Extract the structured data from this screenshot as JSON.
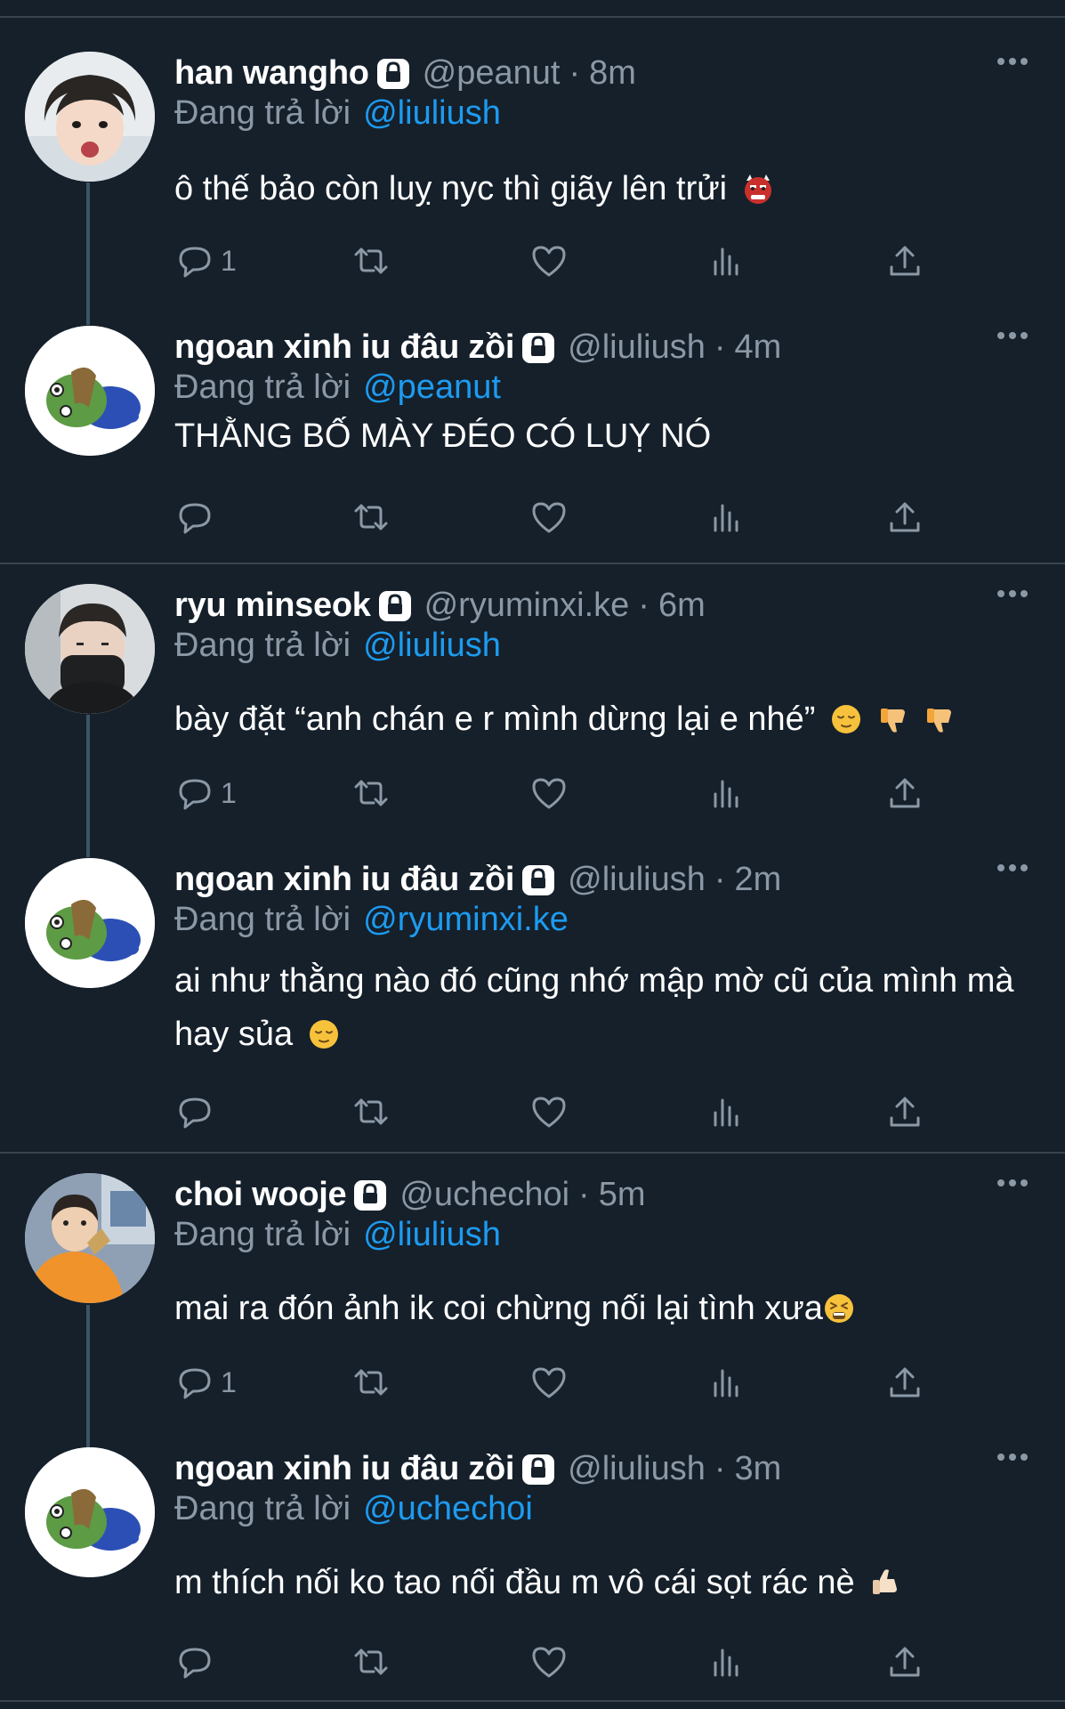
{
  "reply_prefix": "Đang trả lời",
  "dot": "·",
  "colors": {
    "background": "#15202b",
    "divider": "#38444d",
    "secondary_text": "#8b98a5",
    "link": "#1d9bf0",
    "icon": "#8b98a5"
  },
  "tweets": [
    {
      "display_name": "han wangho",
      "handle": "@peanut",
      "time": "8m",
      "reply_to": "@liuliush",
      "text": "ô thế bảo còn luỵ nyc thì giãy lên trửi",
      "emojis": [
        "ogre-emoji"
      ],
      "reply_count": "1",
      "avatar": "photo-avatar"
    },
    {
      "display_name": "ngoan xinh iu đâu zồi",
      "handle": "@liuliush",
      "time": "4m",
      "reply_to": "@peanut",
      "text": "THẰNG BỐ MÀY ĐÉO CÓ LUỴ NÓ",
      "emojis": [],
      "reply_count": "",
      "avatar": "pepe-avatar"
    },
    {
      "display_name": "ryu minseok",
      "handle": "@ryuminxi.ke",
      "time": "6m",
      "reply_to": "@liuliush",
      "text": "bày đặt “anh chán e r mình dừng lại e nhé”",
      "emojis": [
        "relieved-face-emoji",
        "thumbs-down-emoji",
        "thumbs-down-emoji"
      ],
      "reply_count": "1",
      "avatar": "photo-avatar"
    },
    {
      "display_name": "ngoan xinh iu đâu zồi",
      "handle": "@liuliush",
      "time": "2m",
      "reply_to": "@ryuminxi.ke",
      "text": "ai như thằng nào đó cũng nhớ mập mờ cũ của mình mà hay sủa",
      "emojis": [
        "relieved-face-emoji"
      ],
      "reply_count": "",
      "avatar": "pepe-avatar"
    },
    {
      "display_name": "choi wooje",
      "handle": "@uchechoi",
      "time": "5m",
      "reply_to": "@liuliush",
      "text": "mai ra đón ảnh ik coi chừng nối lại tình xưa",
      "emojis": [
        "tired-face-emoji"
      ],
      "reply_count": "1",
      "avatar": "photo-avatar"
    },
    {
      "display_name": "ngoan xinh iu đâu zồi",
      "handle": "@liuliush",
      "time": "3m",
      "reply_to": "@uchechoi",
      "text": "m thích nối ko tao nối đầu m vô cái sọt rác nè",
      "emojis": [
        "thumbs-up-emoji"
      ],
      "reply_count": "",
      "avatar": "pepe-avatar"
    }
  ]
}
